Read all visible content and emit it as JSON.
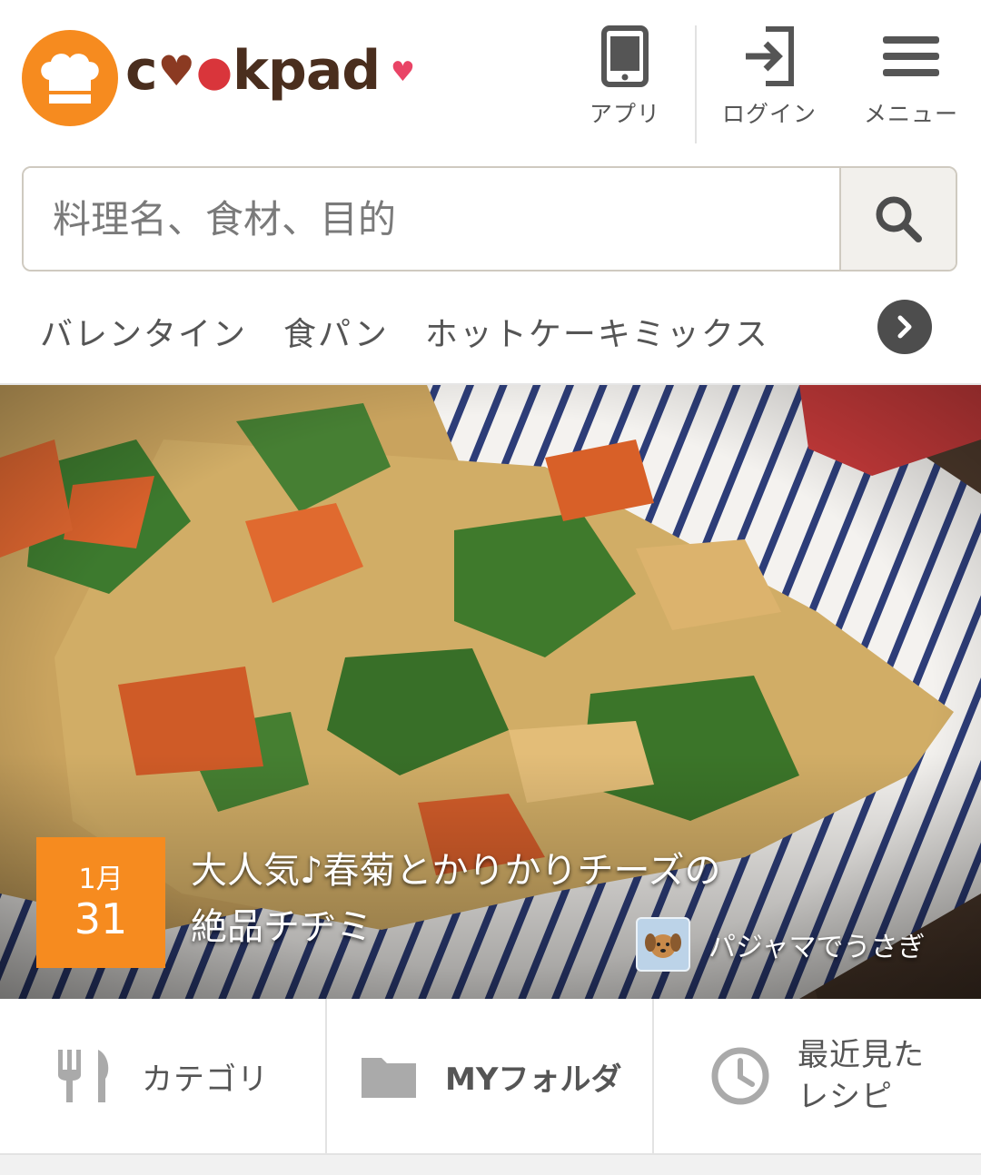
{
  "header": {
    "logo": {
      "letters": [
        "c",
        "kpad"
      ],
      "brand_colors": {
        "orange": "#F68B1F",
        "brown": "#4A2E1E",
        "pink": "#E94466"
      }
    },
    "buttons": {
      "app": "アプリ",
      "login": "ログイン",
      "menu": "メニュー"
    }
  },
  "search": {
    "placeholder": "料理名、食材、目的",
    "icon": "search-icon"
  },
  "keywords": [
    "バレンタイン",
    "食パン",
    "ホットケーキミックス"
  ],
  "hero": {
    "date": {
      "month": "1月",
      "day": "31"
    },
    "title_line1": "大人気♪春菊とかりかりチーズの",
    "title_line2": "絶品チヂミ",
    "author": "パジャマでうさぎ"
  },
  "bottom_nav": {
    "category": "カテゴリ",
    "my_folder": "MYフォルダ",
    "recent_line1": "最近見た",
    "recent_line2": "レシピ"
  }
}
